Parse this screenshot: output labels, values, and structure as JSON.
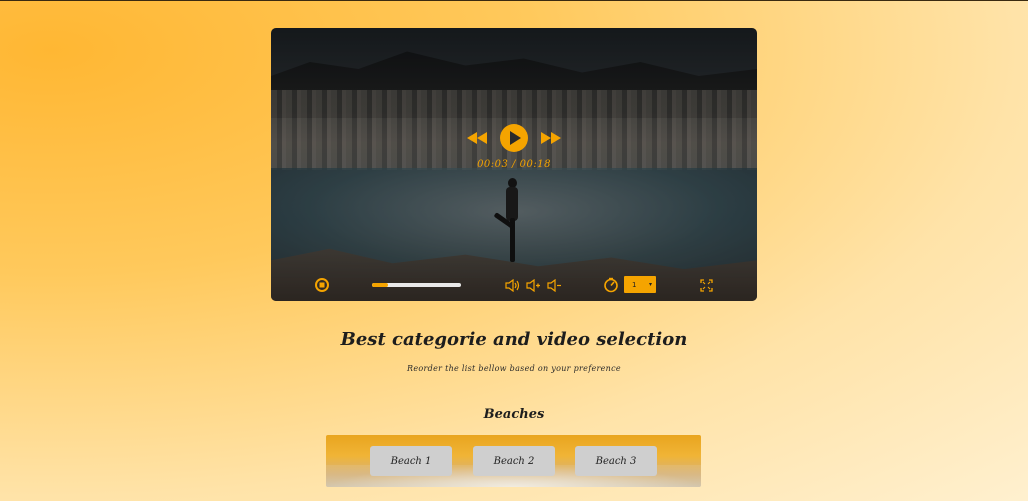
{
  "player": {
    "time_display": "00:03 / 00:18",
    "progress": 0.18,
    "speed": "1",
    "accent_color": "#f5a400",
    "icons": {
      "rewind": "rewind-icon",
      "play": "play-icon",
      "forward": "fast-forward-icon",
      "stop": "stop-icon",
      "volume_up": "volume-up-icon",
      "volume_plus": "volume-plus-icon",
      "volume_minus": "volume-minus-icon",
      "speed": "speedometer-icon",
      "fullscreen": "fullscreen-icon"
    }
  },
  "heading": {
    "title": "Best categorie and video selection",
    "subtitle": "Reorder the list bellow based on your preference"
  },
  "category": {
    "name": "Beaches",
    "items": [
      {
        "label": "Beach 1"
      },
      {
        "label": "Beach 2"
      },
      {
        "label": "Beach 3"
      }
    ]
  }
}
